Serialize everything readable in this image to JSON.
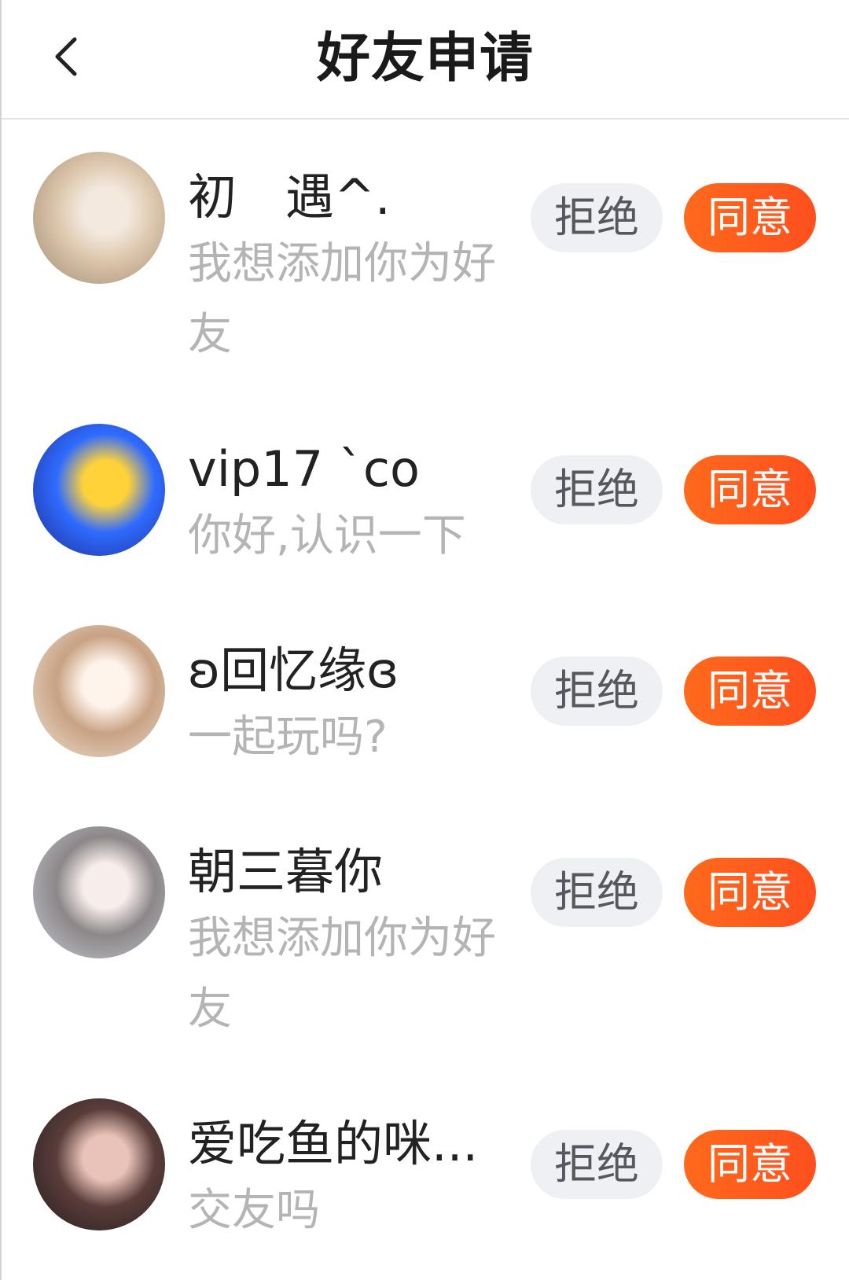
{
  "header": {
    "title": "好友申请",
    "back_icon": "chevron-left-icon"
  },
  "theme": {
    "accept_bg_start": "#ff6a1c",
    "accept_bg_end": "#ff4f1e",
    "reject_bg": "#eef0f4",
    "reject_text": "#55595f",
    "name_text": "#222222",
    "message_text": "#b4b4b4"
  },
  "requests": [
    {
      "name": "初　遇^.",
      "message": "我想添加你为好友",
      "reject_label": "拒绝",
      "accept_label": "同意",
      "avatar_colors": [
        "#f4e9df",
        "#dcc7ad",
        "#9c8771"
      ]
    },
    {
      "name": "vip17 `co",
      "message": "你好,认识一下",
      "reject_label": "拒绝",
      "accept_label": "同意",
      "avatar_colors": [
        "#ffd23a",
        "#2f6bff",
        "#1b2a8f"
      ]
    },
    {
      "name": "ʚ回忆缘ɞ",
      "message": "一起玩吗?",
      "reject_label": "拒绝",
      "accept_label": "同意",
      "avatar_colors": [
        "#fff4ec",
        "#c8a283",
        "#efe4d8"
      ]
    },
    {
      "name": "朝三暮你",
      "message": "我想添加你为好友",
      "reject_label": "拒绝",
      "accept_label": "同意",
      "avatar_colors": [
        "#f6eeea",
        "#8d8789",
        "#c4ccd5"
      ]
    },
    {
      "name": "爱吃鱼的咪...",
      "message": "交友吗",
      "reject_label": "拒绝",
      "accept_label": "同意",
      "avatar_colors": [
        "#e9c3b9",
        "#5a3d3a",
        "#211b1d"
      ]
    }
  ]
}
